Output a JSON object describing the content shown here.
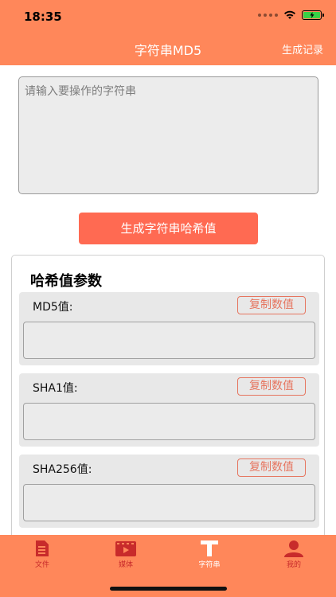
{
  "status_bar": {
    "time": "18:35"
  },
  "header": {
    "title": "字符串MD5",
    "record_label": "生成记录"
  },
  "input": {
    "placeholder": "请输入要操作的字符串",
    "value": ""
  },
  "generate_button": "生成字符串哈希值",
  "panel": {
    "title": "哈希值参数",
    "hashes": [
      {
        "label": "MD5值:",
        "copy_label": "复制数值",
        "value": ""
      },
      {
        "label": "SHA1值:",
        "copy_label": "复制数值",
        "value": ""
      },
      {
        "label": "SHA256值:",
        "copy_label": "复制数值",
        "value": ""
      }
    ]
  },
  "tabbar": {
    "items": [
      {
        "label": "文件",
        "icon": "file-icon"
      },
      {
        "label": "媒体",
        "icon": "video-icon"
      },
      {
        "label": "字符串",
        "icon": "text-icon",
        "active": true
      },
      {
        "label": "我的",
        "icon": "person-icon"
      }
    ]
  },
  "colors": {
    "accent": "#ff875a",
    "button": "#ff6a52",
    "tab_inactive": "#c82b2b"
  }
}
